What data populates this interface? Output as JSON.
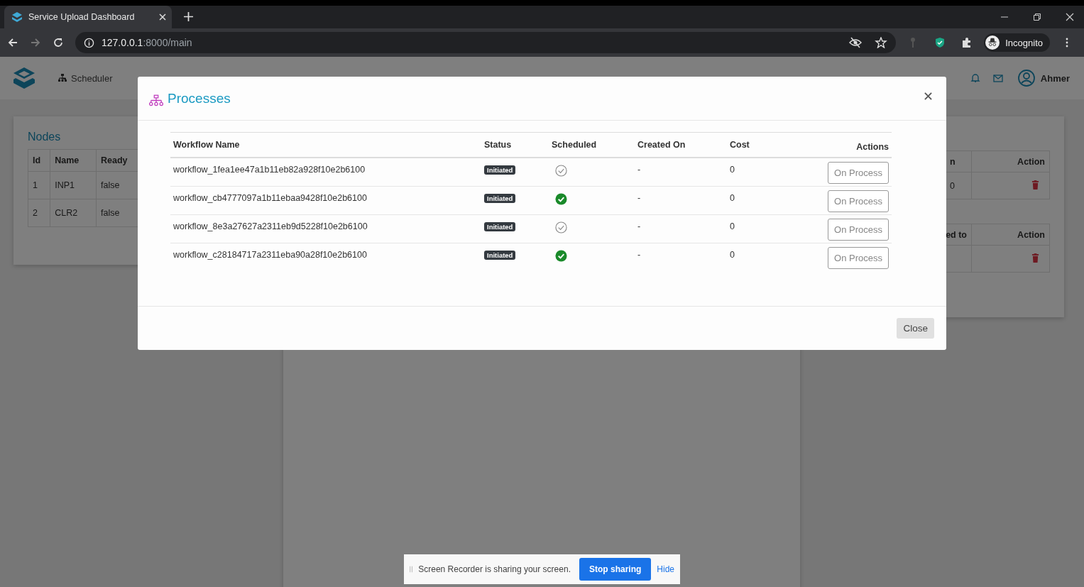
{
  "browser": {
    "tab_title": "Service Upload Dashboard",
    "url_host": "127.0.0.1",
    "url_path": ":8000/main",
    "profile": "Incognito"
  },
  "navbar": {
    "items": [
      {
        "label": "Scheduler"
      }
    ],
    "user": "Ahmer"
  },
  "nodes_card": {
    "title": "Nodes",
    "columns": [
      "Id",
      "Name",
      "Ready"
    ],
    "rows": [
      [
        "1",
        "INP1",
        "false"
      ],
      [
        "2",
        "CLR2",
        "false"
      ]
    ]
  },
  "right_card": {
    "tables": [
      {
        "columns": [
          "n",
          "Action"
        ],
        "rows": [
          {
            "cell": "0"
          }
        ]
      },
      {
        "columns": [
          "ed to",
          "Action"
        ],
        "rows": [
          {
            "cell": ""
          }
        ]
      }
    ]
  },
  "modal": {
    "title": "Processes",
    "columns": [
      "Workflow Name",
      "Status",
      "Scheduled",
      "Created On",
      "Cost",
      "Actions"
    ],
    "rows": [
      {
        "name": "workflow_1fea1ee47a1b11eb82a928f10e2b6100",
        "status": "Initiated",
        "scheduled": false,
        "created_on": "-",
        "cost": "0",
        "action": "On Process"
      },
      {
        "name": "workflow_cb4777097a1b11ebaa9428f10e2b6100",
        "status": "Initiated",
        "scheduled": true,
        "created_on": "-",
        "cost": "0",
        "action": "On Process"
      },
      {
        "name": "workflow_8e3a27627a2311eb9d5228f10e2b6100",
        "status": "Initiated",
        "scheduled": false,
        "created_on": "-",
        "cost": "0",
        "action": "On Process"
      },
      {
        "name": "workflow_c28184717a2311eba90a28f10e2b6100",
        "status": "Initiated",
        "scheduled": true,
        "created_on": "-",
        "cost": "0",
        "action": "On Process"
      }
    ],
    "close_button": "Close"
  },
  "screen_share": {
    "message": "Screen Recorder is sharing your screen.",
    "stop": "Stop sharing",
    "hide": "Hide"
  }
}
